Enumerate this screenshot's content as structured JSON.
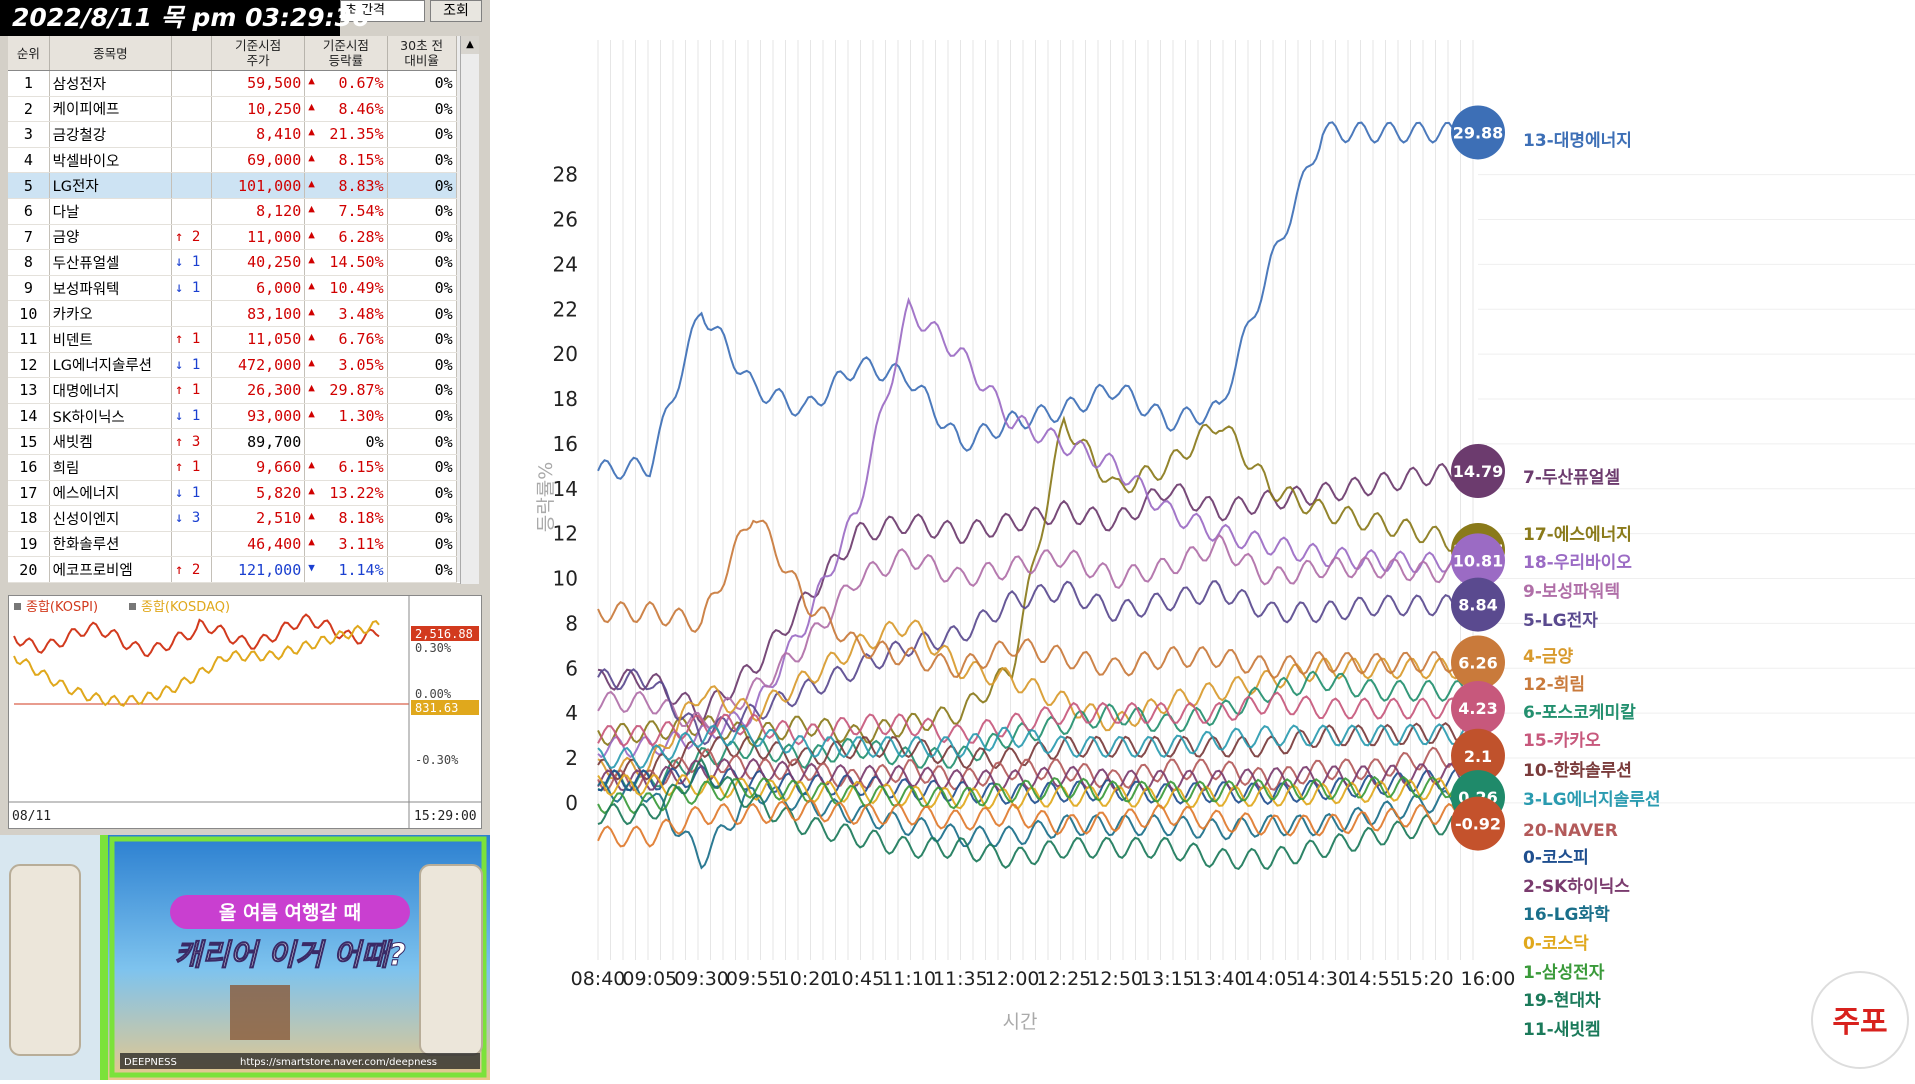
{
  "left": {
    "timestamp": "2022/8/11 목 pm 03:29:36",
    "interval_select": "초 간격",
    "lookup_button": "조회",
    "table": {
      "headers": [
        "순위",
        "종목명",
        "",
        "기준시점\n주가",
        "기준시점\n등락률",
        "30초 전\n대비율"
      ],
      "rows": [
        {
          "rank": "1",
          "name": "삼성전자",
          "move": "",
          "price": "59,500",
          "rate": "0.67%",
          "dir": "up",
          "d30": "0%"
        },
        {
          "rank": "2",
          "name": "케이피에프",
          "move": "",
          "price": "10,250",
          "rate": "8.46%",
          "dir": "up",
          "d30": "0%"
        },
        {
          "rank": "3",
          "name": "금강철강",
          "move": "",
          "price": "8,410",
          "rate": "21.35%",
          "dir": "up",
          "d30": "0%"
        },
        {
          "rank": "4",
          "name": "박셀바이오",
          "move": "",
          "price": "69,000",
          "rate": "8.15%",
          "dir": "up",
          "d30": "0%"
        },
        {
          "rank": "5",
          "name": "LG전자",
          "move": "",
          "price": "101,000",
          "rate": "8.83%",
          "dir": "up",
          "d30": "0%",
          "selected": true
        },
        {
          "rank": "6",
          "name": "다날",
          "move": "",
          "price": "8,120",
          "rate": "7.54%",
          "dir": "up",
          "d30": "0%"
        },
        {
          "rank": "7",
          "name": "금양",
          "move": "↑ 2",
          "price": "11,000",
          "rate": "6.28%",
          "dir": "up",
          "d30": "0%"
        },
        {
          "rank": "8",
          "name": "두산퓨얼셀",
          "move": "↓ 1",
          "price": "40,250",
          "rate": "14.50%",
          "dir": "up",
          "d30": "0%"
        },
        {
          "rank": "9",
          "name": "보성파워텍",
          "move": "↓ 1",
          "price": "6,000",
          "rate": "10.49%",
          "dir": "up",
          "d30": "0%"
        },
        {
          "rank": "10",
          "name": "카카오",
          "move": "",
          "price": "83,100",
          "rate": "3.48%",
          "dir": "up",
          "d30": "0%"
        },
        {
          "rank": "11",
          "name": "비덴트",
          "move": "↑ 1",
          "price": "11,050",
          "rate": "6.76%",
          "dir": "up",
          "d30": "0%"
        },
        {
          "rank": "12",
          "name": "LG에너지솔루션",
          "move": "↓ 1",
          "price": "472,000",
          "rate": "3.05%",
          "dir": "up",
          "d30": "0%"
        },
        {
          "rank": "13",
          "name": "대명에너지",
          "move": "↑ 1",
          "price": "26,300",
          "rate": "29.87%",
          "dir": "up",
          "d30": "0%"
        },
        {
          "rank": "14",
          "name": "SK하이닉스",
          "move": "↓ 1",
          "price": "93,000",
          "rate": "1.30%",
          "dir": "up",
          "d30": "0%"
        },
        {
          "rank": "15",
          "name": "새빗켐",
          "move": "↑ 3",
          "price": "89,700",
          "rate": "0%",
          "dir": "flat",
          "d30": "0%"
        },
        {
          "rank": "16",
          "name": "희림",
          "move": "↑ 1",
          "price": "9,660",
          "rate": "6.15%",
          "dir": "up",
          "d30": "0%"
        },
        {
          "rank": "17",
          "name": "에스에너지",
          "move": "↓ 1",
          "price": "5,820",
          "rate": "13.22%",
          "dir": "up",
          "d30": "0%"
        },
        {
          "rank": "18",
          "name": "신성이엔지",
          "move": "↓ 3",
          "price": "2,510",
          "rate": "8.18%",
          "dir": "up",
          "d30": "0%"
        },
        {
          "rank": "19",
          "name": "한화솔루션",
          "move": "",
          "price": "46,400",
          "rate": "3.11%",
          "dir": "up",
          "d30": "0%"
        },
        {
          "rank": "20",
          "name": "에코프로비엠",
          "move": "↑ 2",
          "price": "121,000",
          "rate": "1.14%",
          "dir": "down",
          "d30": "0%"
        }
      ]
    },
    "mini_chart": {
      "legend_kospi": "종합(KOSPI)",
      "legend_kosdaq": "종합(KOSDAQ)",
      "kospi_value": "2,516.88",
      "kosdaq_value": "831.63",
      "pct_top": "0.30%",
      "pct_mid": "0.00%",
      "pct_bot": "-0.30%",
      "date": "08/11",
      "time": "15:29:00",
      "kospi_color": "#d23a1e",
      "kosdaq_color": "#e0a81c"
    },
    "banner": {
      "line1": "올 여름 여행갈 때",
      "line2": "캐리어 이거 어때?",
      "brand": "DEEPNESS",
      "url": "https://smartstore.naver.com/deepness"
    }
  },
  "chart_data": {
    "type": "line",
    "ylabel": "등락률%",
    "xlabel": "시간",
    "x_ticks": [
      "08:40",
      "09:05",
      "09:30",
      "09:55",
      "10:20",
      "10:45",
      "11:10",
      "11:35",
      "12:00",
      "12:25",
      "12:50",
      "13:15",
      "13:40",
      "14:05",
      "14:30",
      "14:55",
      "15:20",
      "16:00"
    ],
    "y_ticks": [
      0,
      2,
      4,
      6,
      8,
      10,
      12,
      14,
      16,
      18,
      20,
      22,
      24,
      26,
      28
    ],
    "ylim": [
      -7,
      34
    ],
    "grid": "vertical",
    "bubbles": [
      {
        "label": "29.88",
        "y": 29.88,
        "color": "#3d6fb6"
      },
      {
        "label": "14.79",
        "y": 14.79,
        "color": "#6c3b6e"
      },
      {
        "label": "11.27",
        "y": 11.27,
        "color": "#8a7a1a"
      },
      {
        "label": "10.81",
        "y": 10.81,
        "color": "#9b6bc4"
      },
      {
        "label": "8.84",
        "y": 8.84,
        "color": "#5a4a8f"
      },
      {
        "label": "6.26",
        "y": 6.26,
        "color": "#c97a3b"
      },
      {
        "label": "4.23",
        "y": 4.23,
        "color": "#c7587c"
      },
      {
        "label": "2.1",
        "y": 2.1,
        "color": "#c0522c"
      },
      {
        "label": "0.26",
        "y": 0.26,
        "color": "#1f8a6a"
      },
      {
        "label": "-0.92",
        "y": -0.92,
        "color": "#c4522c"
      }
    ],
    "series": [
      {
        "name": "13-대명에너지",
        "color": "#3d6fb6",
        "values": [
          14.8,
          15.0,
          22.0,
          18.5,
          17.5,
          19.5,
          19.0,
          16.0,
          17.0,
          17.5,
          18.5,
          17.0,
          17.5,
          24.0,
          29.9,
          29.88,
          29.88,
          29.88
        ]
      },
      {
        "name": "7-두산퓨얼셀",
        "color": "#6c3b6e",
        "values": [
          5.5,
          5.5,
          4.0,
          6.0,
          9.0,
          12.0,
          12.5,
          12.0,
          12.5,
          13.0,
          12.5,
          14.0,
          13.0,
          13.5,
          13.8,
          14.2,
          14.6,
          14.79
        ]
      },
      {
        "name": "17-에스에너지",
        "color": "#8a7a1a",
        "values": [
          3.0,
          3.2,
          3.5,
          3.0,
          3.5,
          3.0,
          3.5,
          4.0,
          6.0,
          17.0,
          14.0,
          15.0,
          17.0,
          14.0,
          13.0,
          12.5,
          12.0,
          11.27
        ]
      },
      {
        "name": "18-우리바이오",
        "color": "#9b6bc4",
        "values": [
          2.5,
          2.5,
          3.0,
          4.0,
          8.0,
          13.0,
          22.0,
          20.0,
          17.0,
          16.0,
          15.0,
          13.0,
          12.0,
          11.5,
          11.0,
          10.8,
          10.7,
          10.81
        ]
      },
      {
        "name": "9-보성파워텍",
        "color": "#b06fa8",
        "values": [
          4.5,
          4.5,
          3.5,
          5.0,
          7.0,
          10.0,
          11.0,
          10.0,
          10.5,
          11.0,
          10.0,
          10.5,
          11.5,
          10.0,
          10.5,
          10.5,
          10.3,
          10.2
        ]
      },
      {
        "name": "5-LG전자",
        "color": "#5a4a8f",
        "values": [
          5.5,
          5.5,
          3.0,
          4.0,
          5.0,
          6.0,
          7.0,
          7.5,
          9.0,
          9.5,
          8.5,
          9.0,
          9.5,
          8.5,
          8.5,
          8.8,
          8.8,
          8.84
        ]
      },
      {
        "name": "4-금양",
        "color": "#d89a2c",
        "values": [
          1.5,
          1.6,
          5.0,
          4.0,
          5.5,
          7.0,
          8.0,
          6.0,
          5.5,
          4.5,
          3.5,
          4.5,
          5.0,
          5.5,
          6.0,
          6.0,
          6.0,
          6.0
        ]
      },
      {
        "name": "12-희림",
        "color": "#c97a3b",
        "values": [
          8.5,
          8.5,
          8.0,
          13.0,
          9.0,
          7.0,
          6.5,
          6.0,
          7.0,
          6.5,
          6.0,
          6.5,
          6.5,
          6.0,
          6.3,
          6.2,
          6.3,
          6.26
        ]
      },
      {
        "name": "6-포스코케미칼",
        "color": "#23906f",
        "values": [
          1.0,
          1.0,
          2.0,
          2.5,
          2.0,
          2.5,
          2.0,
          2.0,
          3.0,
          3.5,
          4.0,
          3.5,
          4.0,
          5.0,
          5.5,
          5.0,
          5.0,
          5.0
        ]
      },
      {
        "name": "15-카카오",
        "color": "#c7587c",
        "values": [
          3.0,
          3.0,
          3.5,
          3.5,
          3.0,
          3.5,
          3.5,
          3.0,
          3.5,
          4.0,
          4.0,
          4.0,
          4.0,
          4.5,
          4.2,
          4.2,
          4.2,
          4.23
        ]
      },
      {
        "name": "10-한화솔루션",
        "color": "#7a3b3b",
        "values": [
          1.5,
          1.5,
          2.5,
          2.5,
          2.0,
          2.5,
          2.5,
          2.0,
          2.0,
          2.5,
          2.5,
          2.5,
          2.5,
          2.5,
          3.0,
          3.0,
          3.1,
          3.11
        ]
      },
      {
        "name": "3-LG에너지솔루션",
        "color": "#2a9bb0",
        "values": [
          2.0,
          2.0,
          3.0,
          3.0,
          2.5,
          2.5,
          2.5,
          2.5,
          3.0,
          2.5,
          2.5,
          2.5,
          2.8,
          3.0,
          3.0,
          3.0,
          3.05,
          3.05
        ]
      },
      {
        "name": "20-NAVER",
        "color": "#b35a5a",
        "values": [
          1.0,
          1.0,
          2.0,
          1.5,
          1.5,
          1.0,
          1.5,
          1.0,
          1.5,
          1.5,
          1.0,
          1.5,
          1.5,
          1.0,
          1.5,
          1.5,
          2.0,
          2.1
        ]
      },
      {
        "name": "0-코스피",
        "color": "#1f4f8f",
        "values": [
          1.0,
          1.0,
          1.2,
          1.0,
          0.8,
          0.8,
          0.6,
          0.5,
          0.4,
          0.5,
          0.6,
          0.4,
          0.5,
          0.4,
          0.6,
          0.8,
          1.0,
          1.1
        ]
      },
      {
        "name": "2-SK하이닉스",
        "color": "#7a3b6e",
        "values": [
          1.0,
          1.0,
          1.5,
          1.5,
          1.3,
          1.2,
          1.2,
          1.0,
          1.0,
          1.2,
          1.0,
          1.0,
          1.0,
          1.1,
          1.2,
          1.2,
          1.3,
          1.3
        ]
      },
      {
        "name": "16-LG화학",
        "color": "#1a6f8a",
        "values": [
          0.5,
          0.5,
          -2.5,
          0.5,
          0.0,
          -0.5,
          -1.0,
          -1.5,
          -1.5,
          -1.0,
          -1.0,
          -1.0,
          -1.2,
          -1.0,
          -1.0,
          -0.5,
          0.0,
          0.26
        ]
      },
      {
        "name": "0-코스닥",
        "color": "#e0a81c",
        "values": [
          0.8,
          0.8,
          0.8,
          0.6,
          0.5,
          0.5,
          0.3,
          0.2,
          0.2,
          0.3,
          0.3,
          0.2,
          0.3,
          0.3,
          0.4,
          0.5,
          0.6,
          0.8
        ]
      },
      {
        "name": "1-삼성전자",
        "color": "#3a9a3a",
        "values": [
          0.0,
          0.0,
          0.5,
          0.7,
          0.5,
          0.3,
          0.3,
          0.2,
          0.5,
          0.7,
          0.5,
          0.5,
          0.5,
          0.6,
          0.6,
          0.7,
          0.7,
          0.67
        ]
      },
      {
        "name": "19-현대차",
        "color": "#1b7a5a",
        "values": [
          -0.5,
          -0.5,
          1.5,
          0.0,
          -1.0,
          -1.5,
          -2.0,
          -2.0,
          -2.5,
          -2.0,
          -2.0,
          -2.0,
          -2.5,
          -2.5,
          -2.0,
          -1.5,
          -1.0,
          -0.92
        ]
      },
      {
        "name": "11-새빗켐",
        "color": "#e07a2c",
        "values": [
          -1.5,
          -1.5,
          -0.5,
          -0.5,
          -0.3,
          -0.5,
          -0.5,
          -0.8,
          -0.5,
          -1.0,
          -0.8,
          -0.5,
          -0.8,
          -1.0,
          -1.0,
          -0.8,
          -0.5,
          -0.5
        ]
      }
    ],
    "legend": [
      {
        "label": "13-대명에너지",
        "color": "#3d6fb6"
      },
      {
        "label": "7-두산퓨얼셀",
        "color": "#6c3b6e"
      },
      {
        "label": "17-에스에너지",
        "color": "#8a7a1a"
      },
      {
        "label": "18-우리바이오",
        "color": "#9b6bc4"
      },
      {
        "label": "9-보성파워텍",
        "color": "#b06fa8"
      },
      {
        "label": "5-LG전자",
        "color": "#5a4a8f"
      },
      {
        "label": "4-금양",
        "color": "#d89a2c"
      },
      {
        "label": "12-희림",
        "color": "#c97a3b"
      },
      {
        "label": "6-포스코케미칼",
        "color": "#23906f"
      },
      {
        "label": "15-카카오",
        "color": "#c7587c"
      },
      {
        "label": "10-한화솔루션",
        "color": "#7a3b3b"
      },
      {
        "label": "3-LG에너지솔루션",
        "color": "#2a9bb0"
      },
      {
        "label": "20-NAVER",
        "color": "#b35a5a"
      },
      {
        "label": "0-코스피",
        "color": "#1f4f8f"
      },
      {
        "label": "2-SK하이닉스",
        "color": "#7a3b6e"
      },
      {
        "label": "16-LG화학",
        "color": "#1a6f8a"
      },
      {
        "label": "0-코스닥",
        "color": "#e0a81c"
      },
      {
        "label": "1-삼성전자",
        "color": "#3a9a3a"
      },
      {
        "label": "19-현대차",
        "color": "#1b7a5a"
      },
      {
        "label": "11-새빗켐",
        "color": "#1b7a5a"
      }
    ]
  },
  "watermark": {
    "text": "주포"
  }
}
